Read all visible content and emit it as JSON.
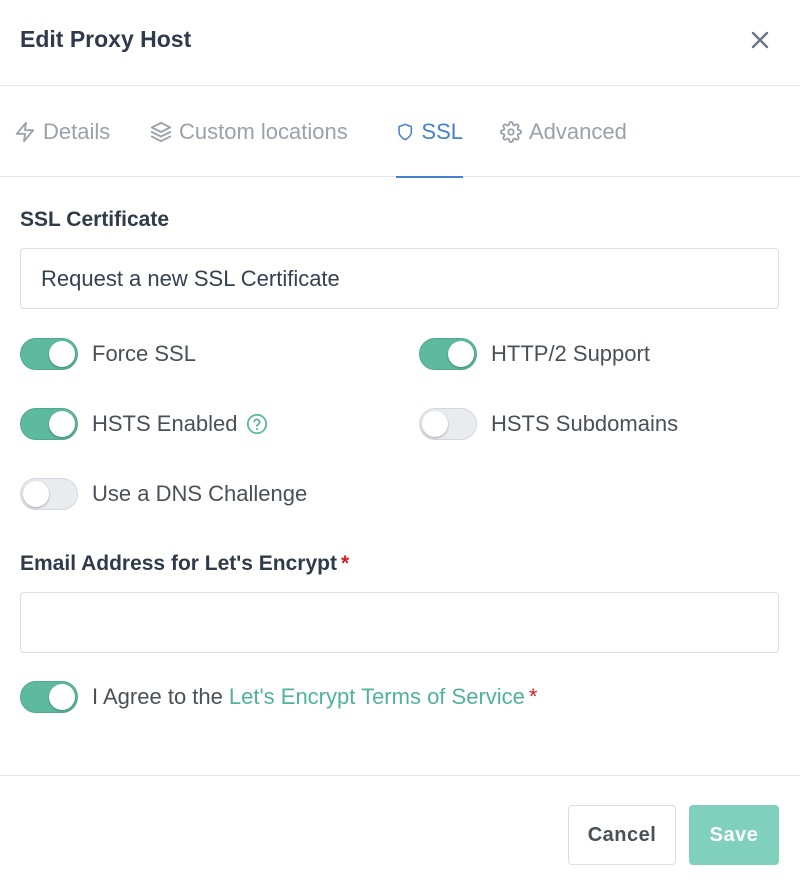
{
  "modal": {
    "title": "Edit Proxy Host",
    "close_icon": "close-icon"
  },
  "tabs": [
    {
      "label": "Details",
      "icon": "zap-icon",
      "active": false
    },
    {
      "label": "Custom locations",
      "icon": "layers-icon",
      "active": false
    },
    {
      "label": "SSL",
      "icon": "shield-icon",
      "active": true
    },
    {
      "label": "Advanced",
      "icon": "gear-icon",
      "active": false
    }
  ],
  "ssl": {
    "certificate_label": "SSL Certificate",
    "certificate_value": "Request a new SSL Certificate",
    "toggles": {
      "force_ssl": {
        "label": "Force SSL",
        "on": true
      },
      "http2": {
        "label": "HTTP/2 Support",
        "on": true
      },
      "hsts_enabled": {
        "label": "HSTS Enabled",
        "on": true
      },
      "hsts_subdomains": {
        "label": "HSTS Subdomains",
        "on": false
      },
      "dns_challenge": {
        "label": "Use a DNS Challenge",
        "on": false
      }
    },
    "email_label": "Email Address for Let's Encrypt",
    "required_mark": "*",
    "email_value": "",
    "agree_prefix": "I Agree to the",
    "agree_link": "Let's Encrypt Terms of Service",
    "agree_on": true
  },
  "footer": {
    "cancel_label": "Cancel",
    "save_label": "Save"
  },
  "colors": {
    "accent": "#467fcf",
    "toggle_on": "#5eba9f",
    "link": "#4fb39a",
    "save_button": "#7fd1bd"
  }
}
